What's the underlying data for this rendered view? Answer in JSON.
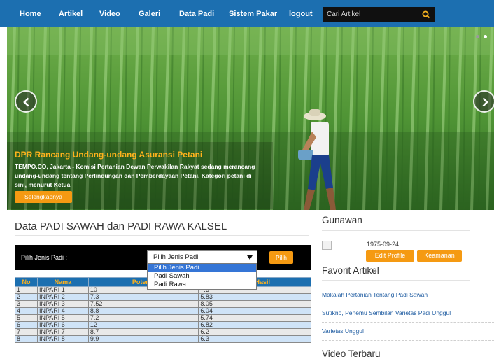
{
  "nav": {
    "items": [
      "Home",
      "Artikel",
      "Video",
      "Galeri",
      "Data Padi",
      "Sistem Pakar",
      "logout"
    ],
    "search_placeholder": "Cari Artikel",
    "search_icon": "search-icon"
  },
  "colors": {
    "nav_bg": "#1c6fb0",
    "accent": "#f59a12",
    "caption_title": "#ffb21c"
  },
  "slider": {
    "title": "DPR Rancang Undang-undang Asuransi Petani",
    "text": "TEMPO.CO, Jakarta - Komisi Pertanian Dewan Perwakilan Rakyat sedang merancang undang-undang tentang Perlindungan dan Pemberdayaan Petani. Kategori petani di sini, menurut Ketua",
    "button": "Selengkapnya",
    "prev_icon": "chevron-left-icon",
    "next_icon": "chevron-right-icon"
  },
  "main": {
    "title": "Data PADI SAWAH dan PADI RAWA KALSEL",
    "filter_label": "Pilih Jenis Padi :",
    "select_value": "Pilih Jenis Padi",
    "select_options": [
      "Pilih Jenis Padi",
      "Padi Sawah",
      "Padi Rawa"
    ],
    "pilih_button": "Pilih",
    "table": {
      "headers": [
        "No",
        "Nama",
        "Potensi",
        "Rata Hasil"
      ],
      "rows": [
        [
          "1",
          "INPARI 1",
          "10",
          "7.3"
        ],
        [
          "2",
          "INPARI 2",
          "7.3",
          "5.83"
        ],
        [
          "3",
          "INPARI 3",
          "7.52",
          "8.05"
        ],
        [
          "4",
          "INPARI 4",
          "8.8",
          "6.04"
        ],
        [
          "5",
          "INPARI 5",
          "7.2",
          "5.74"
        ],
        [
          "6",
          "INPARI 6",
          "12",
          "6.82"
        ],
        [
          "7",
          "INPARI 7",
          "8.7",
          "6.2"
        ],
        [
          "8",
          "INPARI 8",
          "9.9",
          "6.3"
        ]
      ]
    }
  },
  "sidebar": {
    "user_name": "Gunawan",
    "dob": "1975-09-24",
    "edit_profile": "Edit Profile",
    "security": "Keamanan",
    "favorite_title": "Favorit Artikel",
    "favorites": [
      "Makalah Pertanian Tentang Padi Sawah",
      "Sutikno, Penemu Sembilan Varietas Padi Unggul",
      "Varietas Unggul"
    ],
    "video_title": "Video Terbaru"
  }
}
